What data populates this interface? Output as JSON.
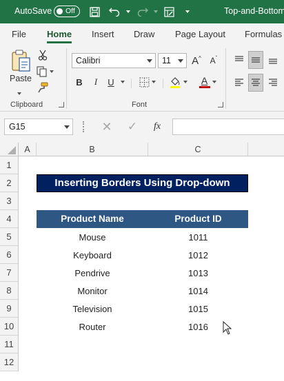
{
  "titlebar": {
    "autosave_label": "AutoSave",
    "toggle_state": "Off",
    "doc_title": "Top-and-Bottom"
  },
  "tabs": [
    "File",
    "Home",
    "Insert",
    "Draw",
    "Page Layout",
    "Formulas"
  ],
  "active_tab": "Home",
  "ribbon": {
    "paste_label": "Paste",
    "clipboard_label": "Clipboard",
    "font_name": "Calibri",
    "font_size": "11",
    "font_label": "Font",
    "bold": "B",
    "italic": "I",
    "underline": "U",
    "grow": "A",
    "shrink": "A",
    "font_color_letter": "A",
    "font_color": "#c00000",
    "fill_color": "#ffff00"
  },
  "formula_bar": {
    "name_box": "G15",
    "fx": "fx",
    "formula": ""
  },
  "grid": {
    "columns": [
      "A",
      "B",
      "C"
    ],
    "rows": [
      "1",
      "2",
      "3",
      "4",
      "5",
      "6",
      "7",
      "8",
      "9",
      "10",
      "11",
      "12"
    ],
    "title": "Inserting Borders Using Drop-down",
    "headers": [
      "Product Name",
      "Product ID"
    ],
    "data": [
      [
        "Mouse",
        "1011"
      ],
      [
        "Keyboard",
        "1012"
      ],
      [
        "Pendrive",
        "1013"
      ],
      [
        "Monitor",
        "1014"
      ],
      [
        "Television",
        "1015"
      ],
      [
        "Router",
        "1016"
      ]
    ]
  },
  "colors": {
    "accent": "#217346",
    "title_fill": "#002060",
    "header_fill": "#2e5784"
  }
}
